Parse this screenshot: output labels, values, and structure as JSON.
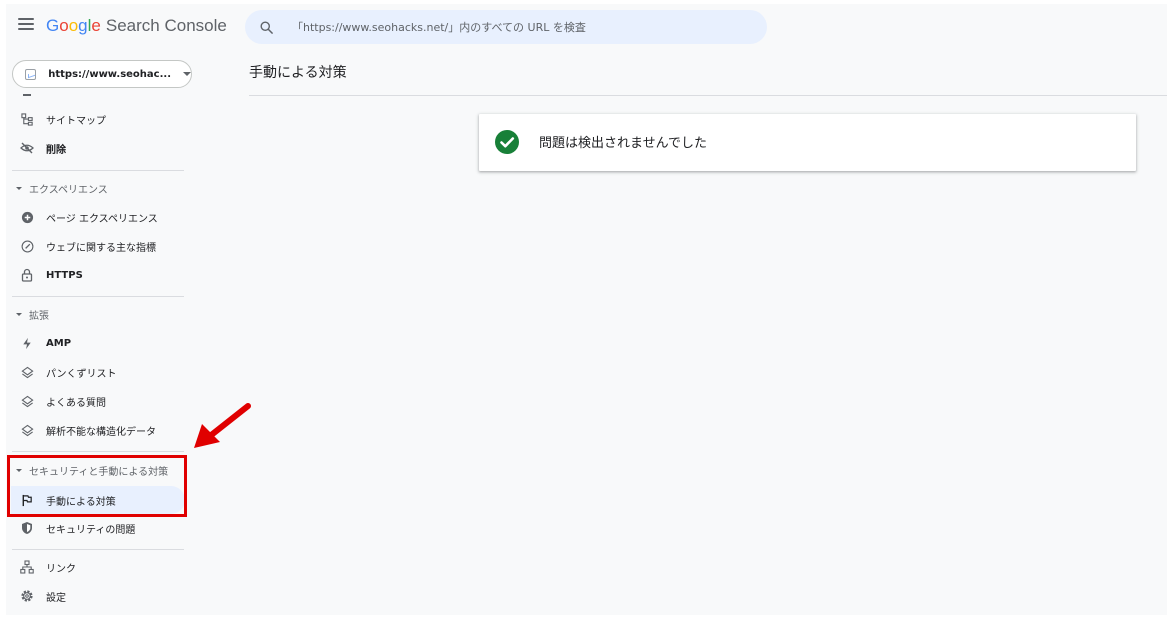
{
  "header": {
    "logo": {
      "G": "G",
      "o1": "o",
      "o2": "o",
      "g": "g",
      "l": "l",
      "e": "e",
      "product": "Search Console"
    },
    "search_placeholder": "「https://www.seohacks.net/」内のすべての URL を検査"
  },
  "property": {
    "label": "https://www.seohac..."
  },
  "sidebar": {
    "items": {
      "sitemap": "サイトマップ",
      "removals": "削除",
      "section_experience": "エクスペリエンス",
      "page_experience": "ページ エクスペリエンス",
      "core_web_vitals": "ウェブに関する主な指標",
      "https": "HTTPS",
      "section_enhancements": "拡張",
      "amp": "AMP",
      "breadcrumbs": "パンくずリスト",
      "faq": "よくある質問",
      "unparsable": "解析不能な構造化データ",
      "section_security": "セキュリティと手動による対策",
      "manual_actions": "手動による対策",
      "security_issues": "セキュリティの問題",
      "links": "リンク",
      "settings": "設定"
    }
  },
  "main": {
    "title": "手動による対策",
    "status_message": "問題は検出されませんでした"
  },
  "colors": {
    "accent": "#1a73e8",
    "active_bg": "#e8f0fe",
    "success": "#188038",
    "annotation": "#e00000"
  }
}
